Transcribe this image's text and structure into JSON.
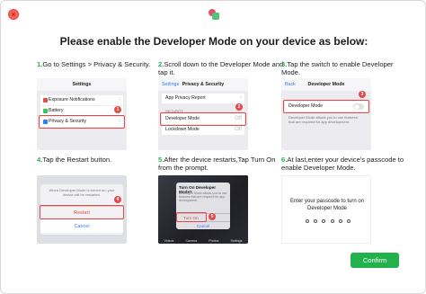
{
  "window": {
    "close_glyph": "×",
    "logo_icon": "app-logo-icon"
  },
  "title": "Please enable the Developer Mode on your device as below:",
  "steps": [
    {
      "num": "1.",
      "text": "Go to Settings > Privacy & Security."
    },
    {
      "num": "2.",
      "text": "Scroll down to the Developer Mode and tap it."
    },
    {
      "num": "3.",
      "text": "Tap the switch to enable Developer Mode."
    },
    {
      "num": "4.",
      "text": "Tap the Restart button."
    },
    {
      "num": "5.",
      "text": "After the device restarts,Tap Turn On from the prompt."
    },
    {
      "num": "6.",
      "text": "At last,enter your device's passcode to enable Developer Mode."
    }
  ],
  "shot1": {
    "nav_title": "Settings",
    "items": [
      "Exposure Notifications",
      "Battery",
      "Privacy & Security"
    ],
    "badge": "1"
  },
  "shot2": {
    "back": "Settings",
    "nav_title": "Privacy & Security",
    "item_top": "App Privacy Report",
    "section": "SECURITY",
    "dev_mode": "Developer Mode",
    "dev_mode_value": "Off",
    "lockdown": "Lockdown Mode",
    "lockdown_value": "Off",
    "badge": "2"
  },
  "shot3": {
    "back": "Back",
    "nav_title": "Developer Mode",
    "row": "Developer Mode",
    "badge": "3",
    "note": "Developer Mode allows you to use features that are required for app development."
  },
  "shot4": {
    "message": "When Developer Mode is turned on, your device will be restarted.",
    "restart": "Restart",
    "cancel": "Cancel",
    "badge": "4"
  },
  "shot5": {
    "alert_title": "Turn On Developer Mode?",
    "alert_body": "Developer Mode allows you to use features that are required for app development.",
    "turn_on": "Turn On",
    "cancel": "Cancel",
    "dock": [
      "Videos",
      "Camera",
      "Photos",
      "Settings"
    ],
    "badge": "5"
  },
  "shot6": {
    "prompt": "Enter your passcode to turn on Developer Mode"
  },
  "confirm_label": "Confirm",
  "colors": {
    "accent_green": "#22b24c",
    "highlight_red": "#e24a4a",
    "ios_blue": "#2f7cf6"
  }
}
